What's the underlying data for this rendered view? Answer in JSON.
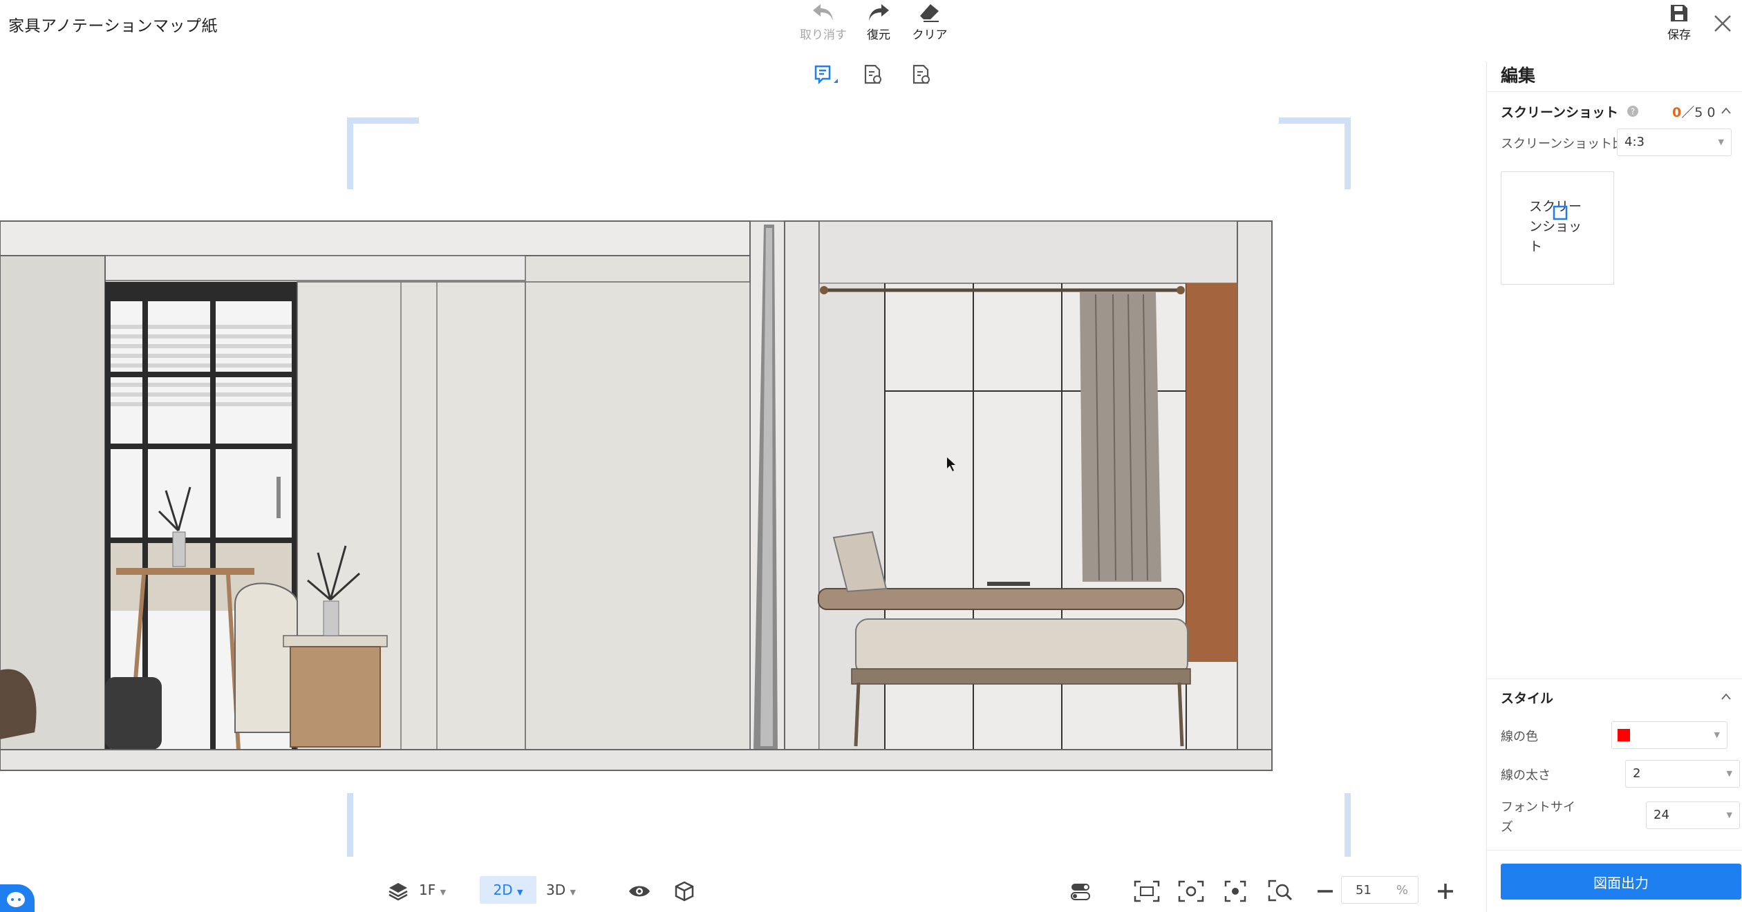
{
  "app": {
    "title": "家具アノテーションマップ紙"
  },
  "toolbar": {
    "undo": "取り消す",
    "redo": "復元",
    "clear": "クリア",
    "save": "保存"
  },
  "panel": {
    "title": "編集",
    "screenshot": {
      "title": "スクリーンショット",
      "count_current": "0",
      "count_sep": "／",
      "count_max": "5 0",
      "ratio_label": "スクリーンショット比率",
      "ratio_value": "4:3",
      "card_label": "スクリーンショット"
    },
    "style": {
      "title": "スタイル",
      "line_color_label": "線の色",
      "line_color": "#ff0000",
      "line_width_label": "線の太さ",
      "line_width_value": "2",
      "font_size_label": "フォントサイズ",
      "font_size_value": "24"
    },
    "export_label": "図面出力"
  },
  "bottom": {
    "floor": "1F",
    "view_2d": "2D",
    "view_3d": "3D",
    "zoom_value": "51",
    "zoom_unit": "%"
  },
  "colors": {
    "accent": "#1e7ff0",
    "count_current": "#e0681a"
  }
}
